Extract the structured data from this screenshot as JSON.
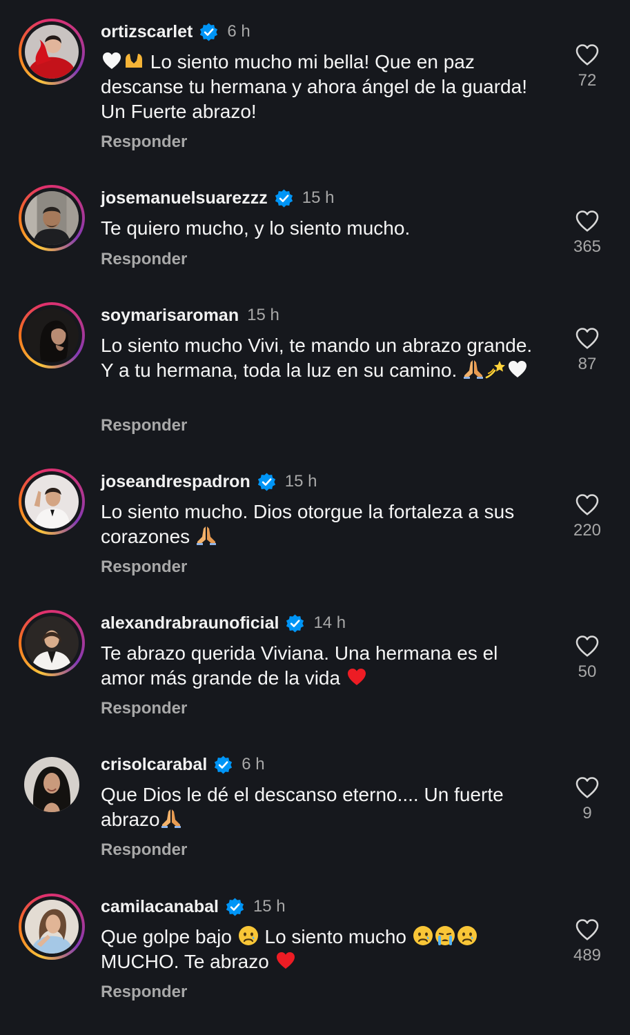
{
  "comments": [
    {
      "username": "ortizscarlet",
      "verified": true,
      "time": "6 h",
      "text": "Lo siento mucho mi bella! Que en paz descanse tu hermana y ahora ángel de la guarda! Un Fuerte abrazo!",
      "reply_label": "Responder",
      "likes": "72"
    },
    {
      "username": "josemanuelsuarezzz",
      "verified": true,
      "time": "15 h",
      "text": "Te quiero mucho, y lo siento mucho.",
      "reply_label": "Responder",
      "likes": "365"
    },
    {
      "username": "soymarisaroman",
      "verified": false,
      "time": "15 h",
      "text": "Lo siento mucho Vivi, te mando un abrazo grande. Y a tu hermana, toda la luz en su camino.",
      "reply_label": "Responder",
      "likes": "87"
    },
    {
      "username": "joseandrespadron",
      "verified": true,
      "time": "15 h",
      "text": "Lo siento mucho. Dios otorgue la fortaleza a sus corazones",
      "reply_label": "Responder",
      "likes": "220"
    },
    {
      "username": "alexandrabraunoficial",
      "verified": true,
      "time": "14 h",
      "text": "Te abrazo querida Viviana. Una hermana es el amor más grande de la vida",
      "reply_label": "Responder",
      "likes": "50"
    },
    {
      "username": "crisolcarabal",
      "verified": true,
      "time": "6 h",
      "text": "Que Dios le dé el descanso eterno.... Un fuerte abrazo",
      "reply_label": "Responder",
      "likes": "9"
    },
    {
      "username": "camilacanabal",
      "verified": true,
      "time": "15 h",
      "text_part1": "Que golpe bajo",
      "text_part2": "Lo siento mucho",
      "text_part3": "MUCHO. Te abrazo",
      "reply_label": "Responder",
      "likes": "489"
    }
  ],
  "colors": {
    "background": "#16181d",
    "text_primary": "#f2f2f2",
    "text_secondary": "#a8a8a8",
    "verified_blue": "#0095f6",
    "heart_red": "#ed1c24"
  },
  "icons": {
    "verified": "verified-badge-icon",
    "like": "heart-outline-icon",
    "emojis": [
      "white-heart",
      "heart-hands",
      "folded-hands",
      "dizzy-star",
      "red-heart",
      "sad-face",
      "crying-face"
    ]
  }
}
